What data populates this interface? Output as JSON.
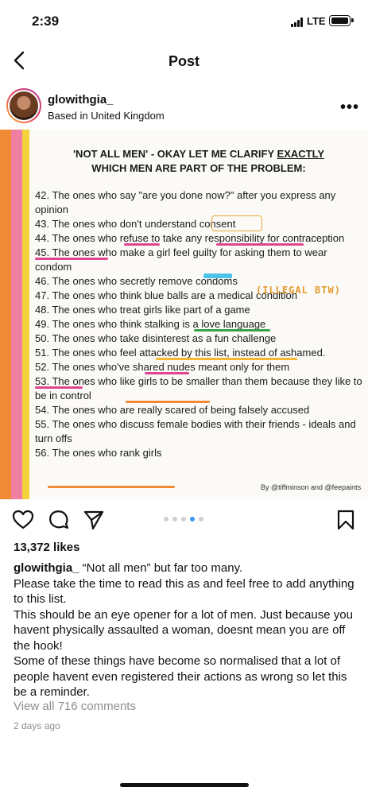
{
  "status": {
    "time": "2:39",
    "network": "LTE"
  },
  "header": {
    "title": "Post"
  },
  "author": {
    "username": "glowithgia_",
    "location": "Based in United Kingdom"
  },
  "image": {
    "title_line1_prefix": "'NOT ALL MEN' - OKAY LET ME CLARIFY ",
    "title_line1_emph": "EXACTLY",
    "title_line2": "WHICH MEN ARE PART OF THE PROBLEM:",
    "items": [
      "42. The ones who say \"are you done now?\" after you express any opinion",
      "43. The ones who don't understand consent",
      "44. The ones who refuse to take any responsibility for contraception",
      "45. The ones who make a girl feel guilty for asking them to wear condom",
      "46. The ones who secretly remove condoms",
      "47. The ones who think blue balls are a medical condition",
      "48. The ones who treat girls like part of a game",
      "49. The ones who think stalking is a love language",
      "50. The ones who take disinterest as a fun challenge",
      "51. The ones who feel attacked by this list, instead of ashamed.",
      "52. The ones who've shared nudes meant only for them",
      "53. The ones who like girls to be smaller than them because they like to be in control",
      "54. The ones who are really scared of being falsely accused",
      "55. The ones who discuss female bodies with their friends - ideals and turn offs",
      "56. The ones who rank girls"
    ],
    "annotation": "ILLEGAL BTW",
    "credit": "By @tiffminson and @feepaints",
    "colors": {
      "orange": "#f08a34",
      "pink": "#f07fa2",
      "yellow": "#f5d13a",
      "green": "#3aa14a",
      "blue": "#4dc3e8",
      "magenta": "#e0458d"
    }
  },
  "carousel": {
    "total": 5,
    "active_index": 3
  },
  "post": {
    "likes": "13,372 likes",
    "caption_user": "glowithgia_",
    "caption_lines": [
      "“Not all men” but far too many.",
      "Please take the time to read this as and feel free to add anything to this list.",
      "This should be an eye opener for a lot of men. Just because you havent physically assaulted a woman, doesnt mean you are off the hook!",
      "Some of these things have become so normalised that a lot of people havent even registered their actions as wrong so let this be a reminder."
    ],
    "view_comments": "View all 716 comments",
    "time_ago": "2 days ago"
  },
  "icons": [
    "back-chevron-icon",
    "more-options-icon",
    "heart-icon",
    "comment-icon",
    "share-icon",
    "bookmark-icon"
  ]
}
